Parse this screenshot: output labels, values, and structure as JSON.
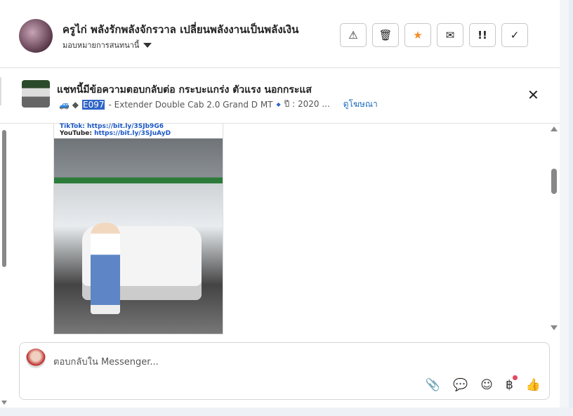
{
  "header": {
    "title": "ครูไก่ พลังรักพลังจักรวาล เปลี่ยนพลังงานเป็นพลังเงิน",
    "assign_label": "มอบหมายการสนทนานี้",
    "actions": [
      {
        "name": "report-button",
        "icon": "⚠"
      },
      {
        "name": "delete-button",
        "icon": "🗑"
      },
      {
        "name": "star-button",
        "icon": "★",
        "color": "#f28c28"
      },
      {
        "name": "mark-unread-button",
        "icon": "✉"
      },
      {
        "name": "priority-button",
        "icon": "!!"
      },
      {
        "name": "done-button",
        "icon": "✓"
      }
    ]
  },
  "ad": {
    "title": "แชทนี้มีข้อความตอบกลับต่อ กระบะแกร่ง ตัวแรง นอกกระแส",
    "emoji": "🚙 ◆",
    "code": "E097",
    "desc": "- Extender Double Cab 2.0 Grand D MT",
    "bullet": "◆",
    "year": "ปี : 2020 ...",
    "link": "ดูโฆษณา",
    "close": "✕"
  },
  "message": {
    "tiktok": "TikTok: https://bit.ly/3SJb9G6",
    "youtube_label": "YouTube:",
    "youtube_url": "https://bit.ly/3SJuAyD"
  },
  "composer": {
    "placeholder": "ตอบกลับใน Messenger...",
    "tools": {
      "attach": "📎",
      "chat": "💬",
      "emoji": "☺",
      "baht": "฿",
      "like": "👍"
    }
  }
}
